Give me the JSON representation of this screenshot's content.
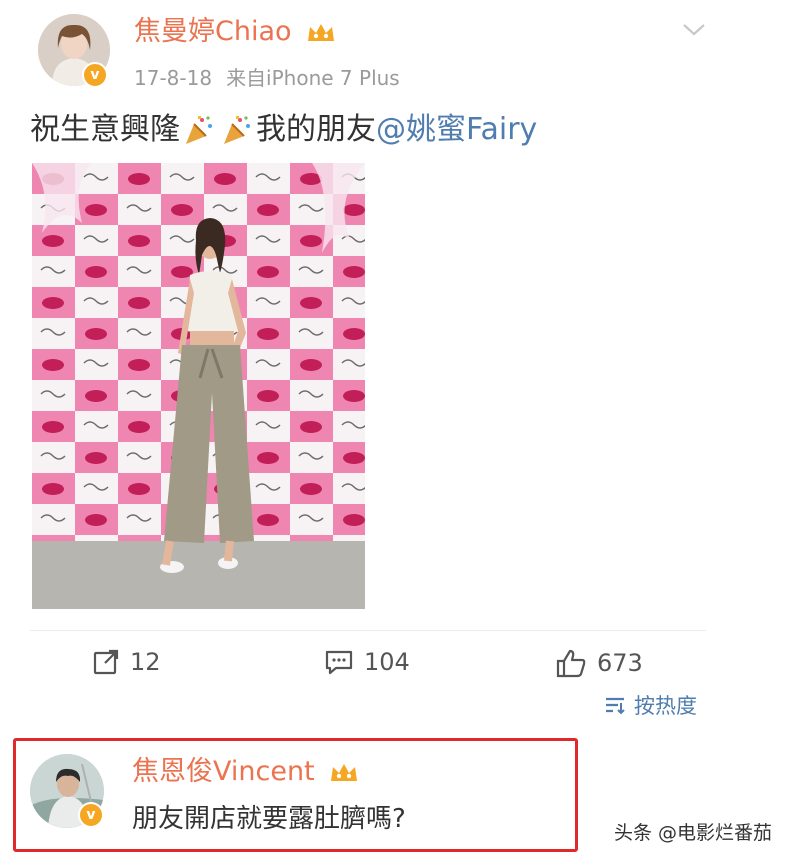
{
  "post": {
    "username": "焦曼婷Chiao",
    "date": "17-8-18",
    "source": "来自iPhone 7 Plus",
    "text_before": "祝生意興隆",
    "text_after": "我的朋友",
    "mention": "@姚蜜Fairy",
    "emoji": "party-popper-icon"
  },
  "actions": {
    "repost_count": "12",
    "comment_count": "104",
    "like_count": "673",
    "sort_label": "按热度"
  },
  "reply": {
    "username": "焦恩俊Vincent",
    "text": "朋友開店就要露肚臍嗎?"
  },
  "watermark": "头条 @电影烂番茄",
  "colors": {
    "username": "#eb7350",
    "link": "#507daf",
    "highlight": "#e0292b",
    "verified": "#f5a623"
  }
}
